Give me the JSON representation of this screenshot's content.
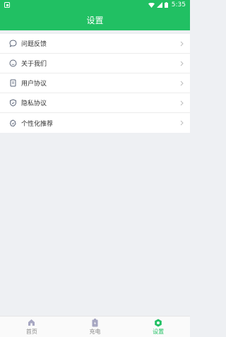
{
  "status_bar": {
    "time": "5:35"
  },
  "header": {
    "title": "设置"
  },
  "settings": {
    "items": [
      {
        "label": "问题反馈",
        "icon": "chat-bubble-icon"
      },
      {
        "label": "关于我们",
        "icon": "info-circle-icon"
      },
      {
        "label": "用户协议",
        "icon": "document-icon"
      },
      {
        "label": "隐私协议",
        "icon": "shield-icon"
      },
      {
        "label": "个性化推荐",
        "icon": "badge-check-icon"
      }
    ]
  },
  "tab_bar": {
    "tabs": [
      {
        "label": "首页",
        "icon": "home-icon",
        "active": false
      },
      {
        "label": "充电",
        "icon": "battery-charging-icon",
        "active": false
      },
      {
        "label": "设置",
        "icon": "gear-icon",
        "active": true
      }
    ]
  },
  "colors": {
    "accent": "#21c063",
    "inactive_tab": "#a7a7c2",
    "background": "#eef0f3"
  }
}
